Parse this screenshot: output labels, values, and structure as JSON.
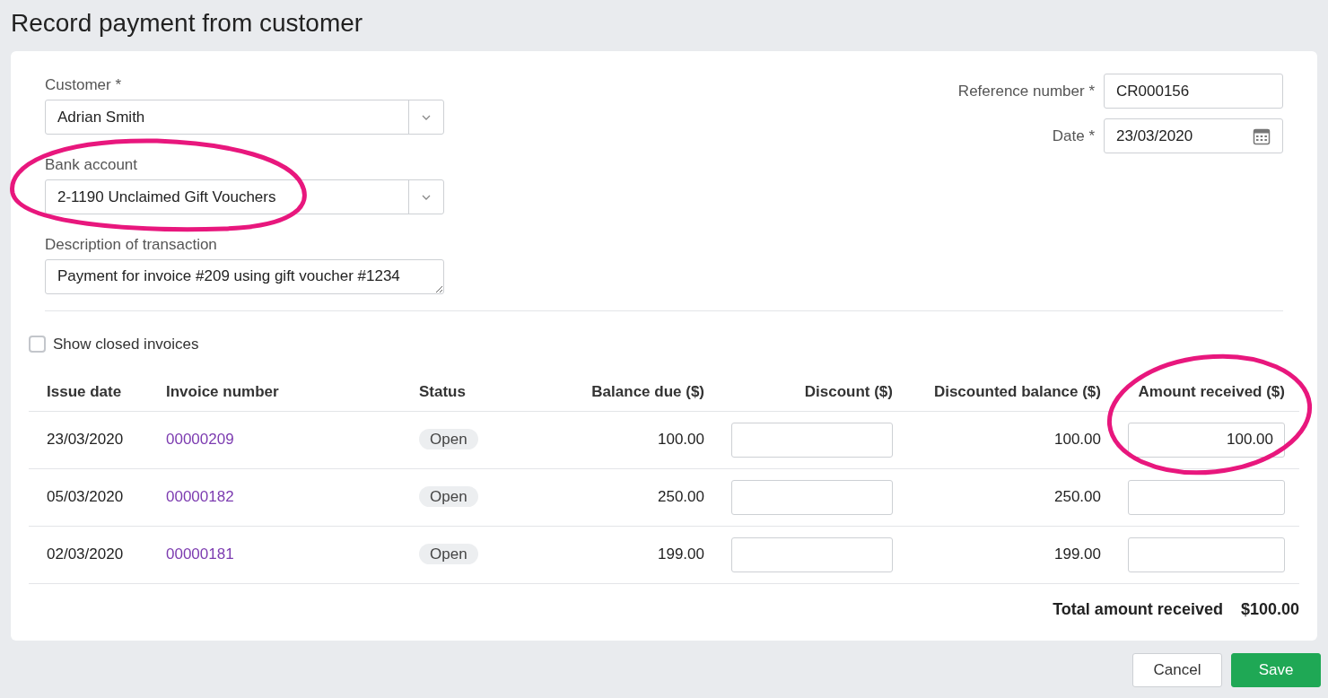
{
  "title": "Record payment from customer",
  "left_fields": [
    {
      "label": "Customer *",
      "value": "Adrian Smith",
      "kind": "select"
    },
    {
      "label": "Bank account",
      "value": "2-1190 Unclaimed Gift Vouchers",
      "kind": "select"
    },
    {
      "label": "Description of transaction",
      "value": "Payment for invoice #209 using gift voucher #1234",
      "kind": "textarea"
    }
  ],
  "right_fields": [
    {
      "label": "Reference number *",
      "value": "CR000156",
      "kind": "text"
    },
    {
      "label": "Date *",
      "value": "23/03/2020",
      "kind": "date"
    }
  ],
  "show_closed_invoices": {
    "label": "Show closed invoices",
    "checked": false
  },
  "table": {
    "columns": [
      "Issue date",
      "Invoice number",
      "Status",
      "Balance due ($)",
      "Discount ($)",
      "Discounted balance ($)",
      "Amount received ($)"
    ],
    "rows": [
      {
        "issue_date": "23/03/2020",
        "invoice_number": "00000209",
        "status": "Open",
        "balance_due": "100.00",
        "discounted_balance": "100.00",
        "amount_received": "100.00"
      },
      {
        "issue_date": "05/03/2020",
        "invoice_number": "00000182",
        "status": "Open",
        "balance_due": "250.00",
        "discounted_balance": "250.00"
      },
      {
        "issue_date": "02/03/2020",
        "invoice_number": "00000181",
        "status": "Open",
        "balance_due": "199.00",
        "discounted_balance": "199.00"
      }
    ]
  },
  "total": {
    "label": "Total amount received",
    "value": "$100.00"
  },
  "buttons": [
    {
      "label": "Cancel",
      "kind": "secondary"
    },
    {
      "label": "Save",
      "kind": "primary"
    }
  ]
}
